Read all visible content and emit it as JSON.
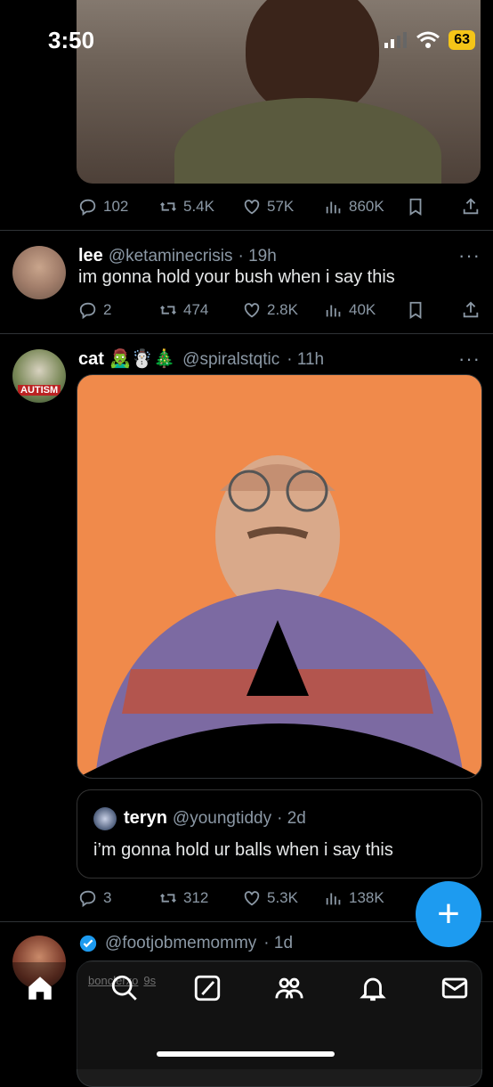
{
  "status": {
    "time": "3:50",
    "battery": "63"
  },
  "tweet1": {
    "reply_count": "102",
    "retweet_count": "5.4K",
    "like_count": "57K",
    "view_count": "860K"
  },
  "tweet2": {
    "name": "lee",
    "handle": "@ketaminecrisis",
    "time": "· 19h",
    "text": "im gonna hold your bush when i say this",
    "reply_count": "2",
    "retweet_count": "474",
    "like_count": "2.8K",
    "view_count": "40K"
  },
  "tweet3": {
    "name": "cat 🧟‍♂️☃️🎄",
    "handle": "@spiralstqtic",
    "time": "· 11h",
    "avatar_label": "AUTISM",
    "quote": {
      "name": "teryn",
      "handle": "@youngtiddy",
      "time": "· 2d",
      "text": "i’m gonna hold ur balls when i say this"
    },
    "reply_count": "3",
    "retweet_count": "312",
    "like_count": "5.3K",
    "view_count": "138K"
  },
  "tweet4": {
    "handle": "@footjobmemommy",
    "time": "· 1d",
    "overlay_user": "bonclerxo",
    "overlay_time": "9s"
  },
  "colors": {
    "accent": "#1d9bf0",
    "battery": "#f5c518",
    "image_bg": "#f08a4b"
  },
  "icons": [
    "reply-icon",
    "retweet-icon",
    "like-icon",
    "views-icon",
    "bookmark-icon",
    "share-icon",
    "home-icon",
    "search-icon",
    "grok-icon",
    "communities-icon",
    "notifications-icon",
    "messages-icon",
    "compose-icon"
  ]
}
